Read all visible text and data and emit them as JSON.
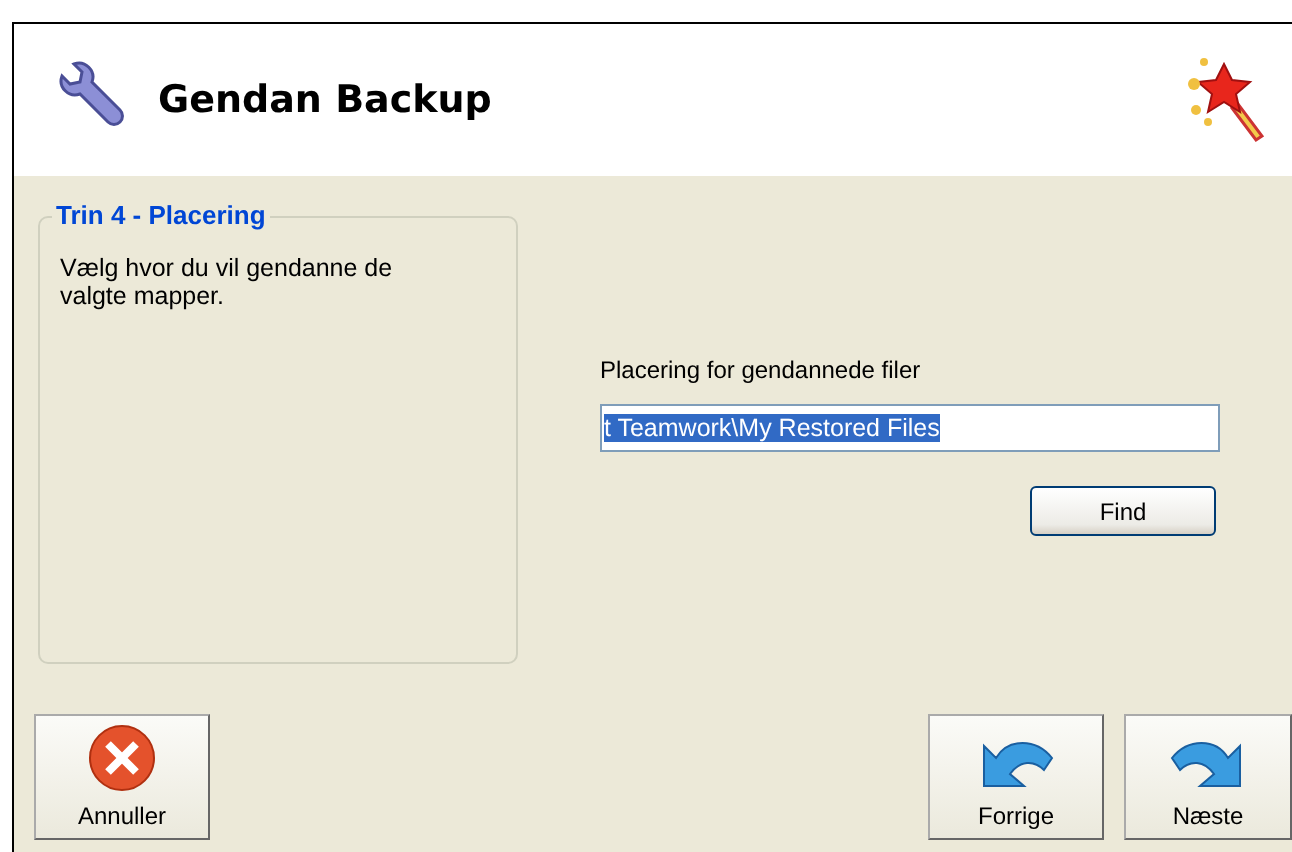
{
  "window": {
    "title": "Gendan Backup"
  },
  "step": {
    "title": "Trin 4 - Placering",
    "description": "Vælg hvor du vil gendanne de valgte mapper."
  },
  "location": {
    "label": "Placering for gendannede filer",
    "value": "t Teamwork\\My Restored Files",
    "text_selected": true,
    "browse_button": "Find"
  },
  "buttons": [
    {
      "kind": "cancel",
      "label": "Annuller"
    },
    {
      "kind": "back",
      "label": "Forrige"
    },
    {
      "kind": "next",
      "label": "Næste"
    }
  ]
}
